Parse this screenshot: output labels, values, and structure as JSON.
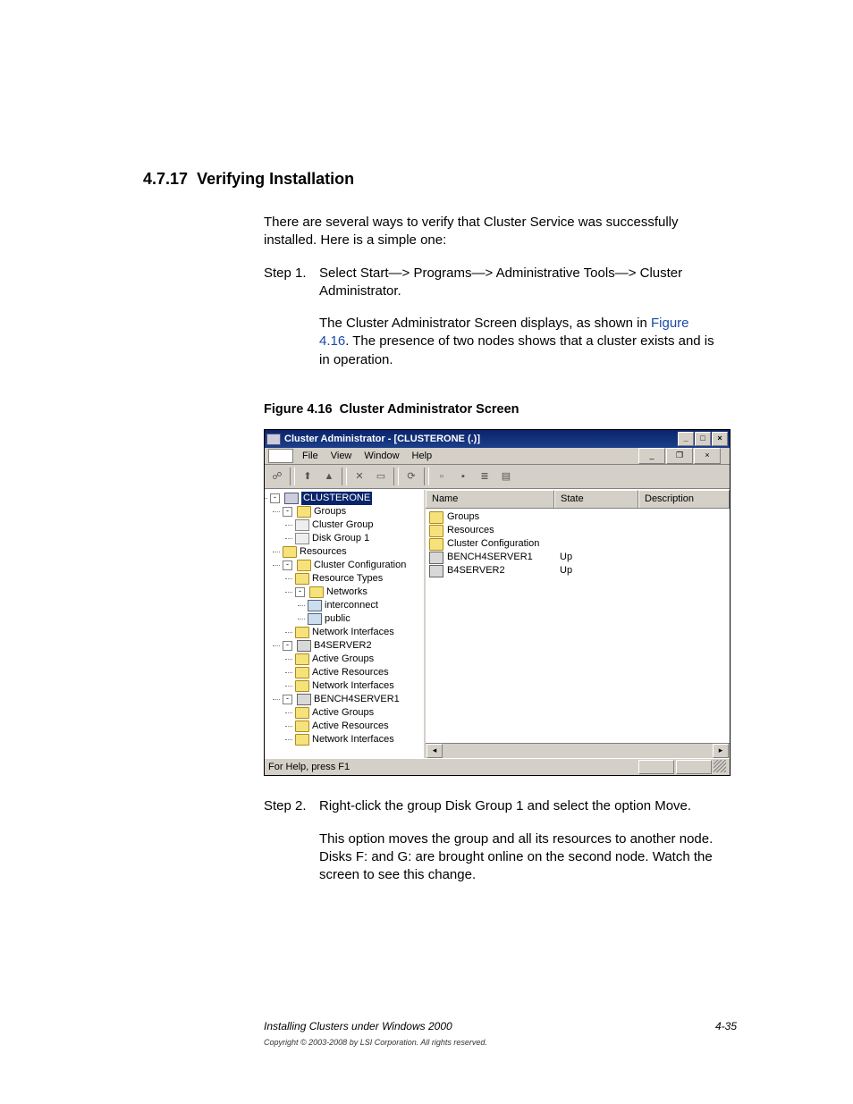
{
  "section": {
    "number": "4.7.17",
    "title": "Verifying Installation"
  },
  "intro": "There are several ways to verify that Cluster Service was successfully installed. Here is a simple one:",
  "step1": {
    "label": "Step 1.",
    "line1": "Select Start—> Programs—> Administrative Tools—> Cluster Administrator.",
    "line2a": "The Cluster Administrator Screen displays, as shown in ",
    "xref": "Figure 4.16",
    "line2b": ". The presence of two nodes shows that a cluster exists and is in operation."
  },
  "figure": {
    "label": "Figure 4.16",
    "title": "Cluster Administrator Screen"
  },
  "window": {
    "title": "Cluster Administrator - [CLUSTERONE (.)]",
    "menus": {
      "file": "File",
      "view": "View",
      "window": "Window",
      "help": "Help"
    },
    "cols": {
      "name": "Name",
      "state": "State",
      "desc": "Description"
    },
    "status": "For Help, press F1"
  },
  "tree": {
    "root": "CLUSTERONE",
    "groups": "Groups",
    "cluster_group": "Cluster Group",
    "disk_group1": "Disk Group 1",
    "resources": "Resources",
    "cluster_config": "Cluster Configuration",
    "resource_types": "Resource Types",
    "networks": "Networks",
    "interconnect": "interconnect",
    "public": "public",
    "net_if": "Network Interfaces",
    "node_b4": "B4SERVER2",
    "node_bench": "BENCH4SERVER1",
    "active_groups": "Active Groups",
    "active_resources": "Active Resources"
  },
  "list": {
    "r1": {
      "name": "Groups",
      "state": ""
    },
    "r2": {
      "name": "Resources",
      "state": ""
    },
    "r3": {
      "name": "Cluster Configuration",
      "state": ""
    },
    "r4": {
      "name": "BENCH4SERVER1",
      "state": "Up"
    },
    "r5": {
      "name": "B4SERVER2",
      "state": "Up"
    }
  },
  "step2": {
    "label": "Step 2.",
    "line1": "Right-click the group Disk Group 1 and select the option Move.",
    "line2": "This option moves the group and all its resources to another node. Disks F: and G: are brought online on the second node. Watch the screen to see this change."
  },
  "footer": {
    "left": "Installing Clusters under Windows 2000",
    "right": "4-35"
  },
  "copyright": "Copyright © 2003-2008 by LSI Corporation. All rights reserved."
}
